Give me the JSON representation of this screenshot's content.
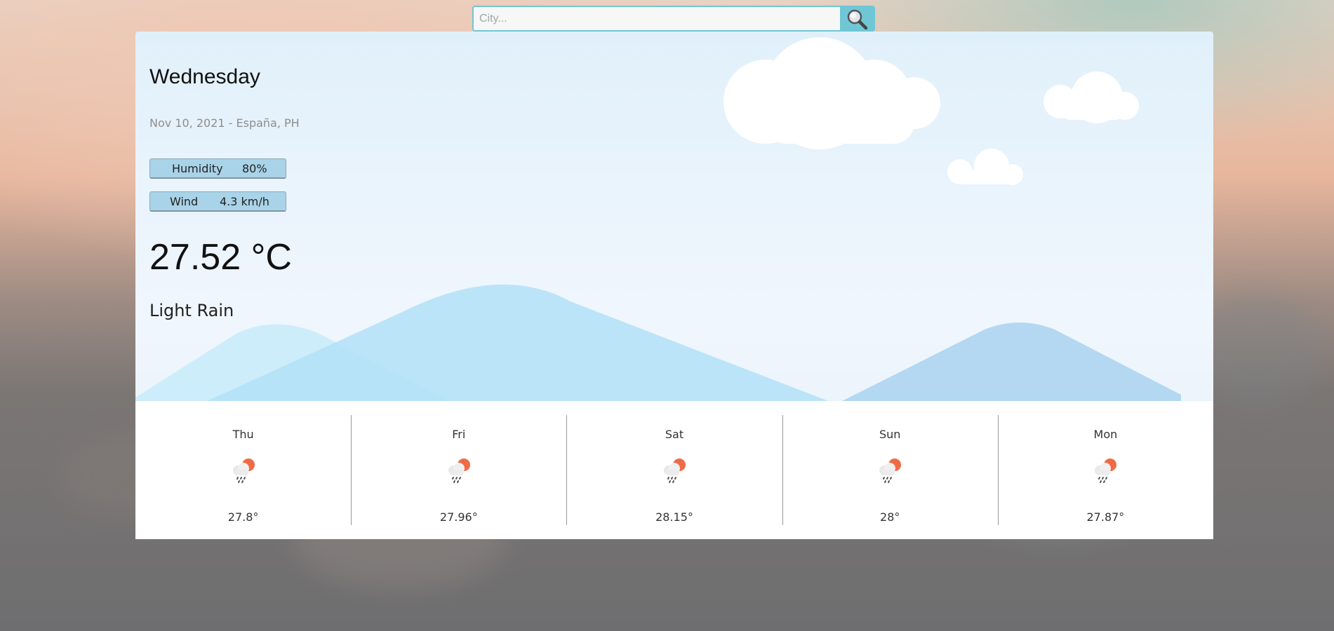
{
  "search": {
    "placeholder": "City...",
    "value": ""
  },
  "current": {
    "day": "Wednesday",
    "date_location": "Nov 10, 2021 - España, PH",
    "humidity_label": "Humidity",
    "humidity_value": "80%",
    "wind_label": "Wind",
    "wind_value": "4.3 km/h",
    "temperature": "27.52 °C",
    "description": "Light Rain"
  },
  "forecast": [
    {
      "day": "Thu",
      "temp": "27.8°",
      "icon": "rain-sun-icon"
    },
    {
      "day": "Fri",
      "temp": "27.96°",
      "icon": "rain-sun-icon"
    },
    {
      "day": "Sat",
      "temp": "28.15°",
      "icon": "rain-sun-icon"
    },
    {
      "day": "Sun",
      "temp": "28°",
      "icon": "rain-sun-icon"
    },
    {
      "day": "Mon",
      "temp": "27.87°",
      "icon": "rain-sun-icon"
    }
  ],
  "colors": {
    "accent": "#6fc7d6",
    "pill": "#a9d3e8",
    "sun": "#ef6b45",
    "cloud": "#ffffff"
  }
}
